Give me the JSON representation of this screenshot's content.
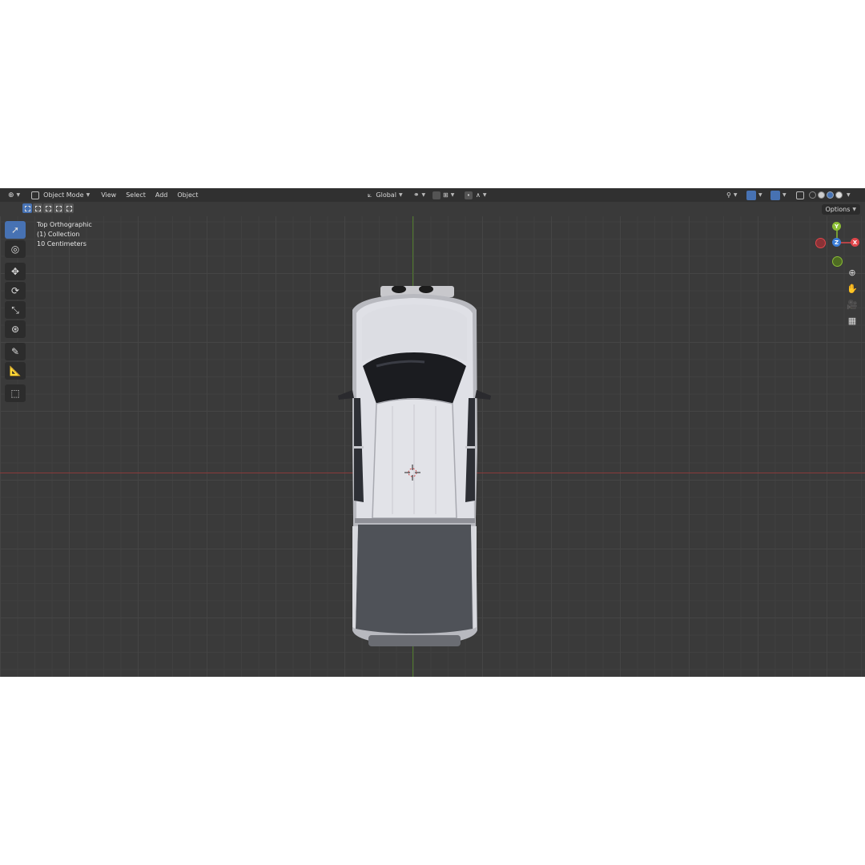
{
  "header": {
    "editor_type_icon": "editor-type-icon",
    "mode_label": "Object Mode",
    "menus": [
      "View",
      "Select",
      "Add",
      "Object"
    ],
    "transform_orientation": "Global"
  },
  "viewport": {
    "view_name": "Top Orthographic",
    "collection": "(1) Collection",
    "grid_scale": "10 Centimeters",
    "options_label": "Options",
    "gizmo": {
      "y": "Y",
      "z": "Z",
      "x": "X"
    },
    "axis_colors": {
      "x": "#e0464b",
      "y": "#8bbd35",
      "z": "#3b7ed8"
    }
  },
  "toolbar": {
    "tools": [
      "select-box-icon",
      "cursor-icon",
      "move-icon",
      "rotate-icon",
      "scale-icon",
      "transform-icon",
      "annotate-icon",
      "measure-icon",
      "add-cube-icon"
    ]
  },
  "navigation": [
    "zoom-icon",
    "hand-pan-icon",
    "camera-icon",
    "grid-ortho-icon"
  ],
  "colors": {
    "accent": "#4772b3",
    "background": "#3a3a3a",
    "header": "#303030"
  }
}
